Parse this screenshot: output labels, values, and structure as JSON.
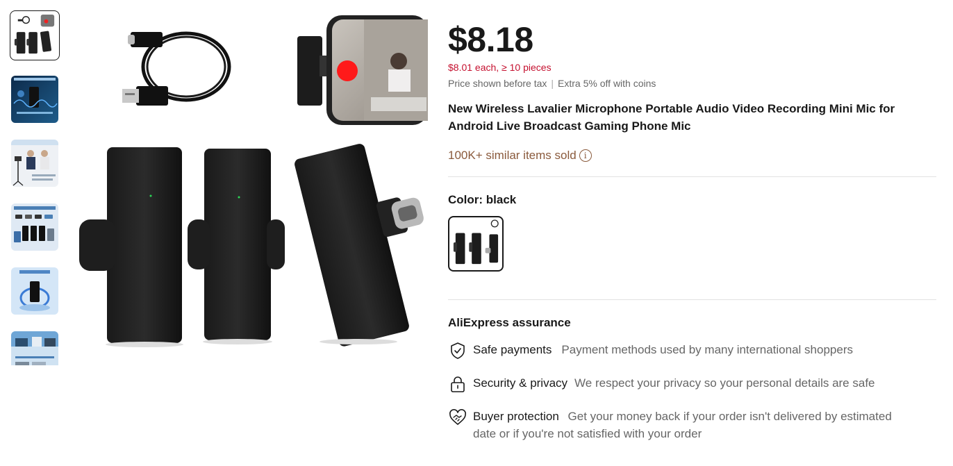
{
  "gallery": {
    "thumbnails": [
      {
        "name": "product-overview"
      },
      {
        "name": "noise-reduction-banner"
      },
      {
        "name": "interview-scene"
      },
      {
        "name": "universal-adapters"
      },
      {
        "name": "long-battery-life"
      },
      {
        "name": "usage-scenarios"
      }
    ],
    "selected_index": 0
  },
  "product": {
    "price": "$8.18",
    "bulk_price": "$8.01 each, ≥ 10 pieces",
    "tax_note": "Price shown before tax",
    "coins_note": "Extra 5% off with coins",
    "title": "New Wireless Lavalier Microphone Portable Audio Video Recording Mini Mic for Android Live Broadcast Gaming Phone Mic",
    "sold": "100K+ similar items sold",
    "color_label": "Color: black"
  },
  "assurance": {
    "title": "AliExpress assurance",
    "items": [
      {
        "head": "Safe payments",
        "desc": "Payment methods used by many international shoppers",
        "icon": "shield-check-icon"
      },
      {
        "head": "Security & privacy",
        "desc": "We respect your privacy so your personal details are safe",
        "icon": "lock-icon"
      },
      {
        "head": "Buyer protection",
        "desc": "Get your money back if your order isn't delivered by estimated date or if you're not satisfied with your order",
        "icon": "handshake-heart-icon"
      }
    ]
  },
  "colors": {
    "accent_red": "#c5102f",
    "sold_brown": "#8a5a3c",
    "text": "#191919",
    "muted": "#666666"
  }
}
